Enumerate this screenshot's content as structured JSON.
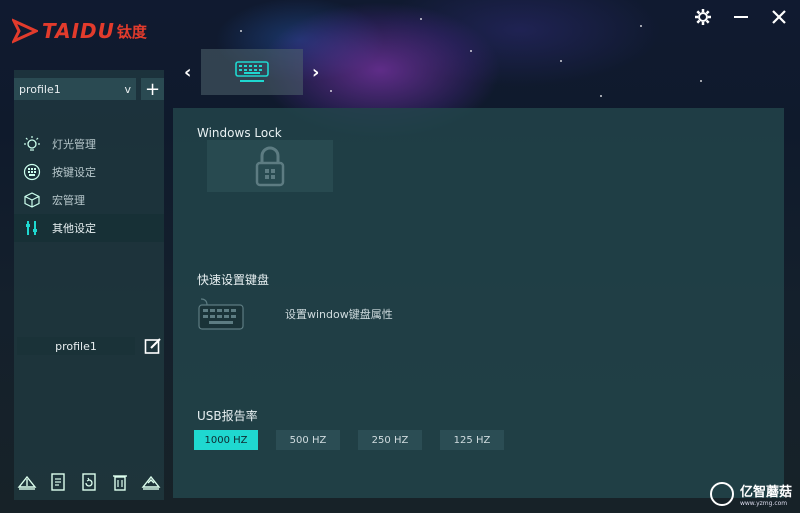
{
  "app": {
    "logo_text": "TAIDU",
    "logo_cn": "钛度"
  },
  "window_controls": {
    "settings_icon": "gear-icon",
    "minimize_icon": "minimize-icon",
    "close_icon": "close-icon"
  },
  "sidebar": {
    "profile_select": {
      "value": "profile1",
      "arrow": "v"
    },
    "add_label": "+",
    "menu": [
      {
        "label": "灯光管理",
        "icon": "light-bulb-icon",
        "active": false
      },
      {
        "label": "按键设定",
        "icon": "key-grid-icon",
        "active": false
      },
      {
        "label": "宏管理",
        "icon": "cube-icon",
        "active": false
      },
      {
        "label": "其他设定",
        "icon": "sliders-icon",
        "active": true
      }
    ],
    "profile_name": "profile1",
    "bottom_icons": [
      "import-icon",
      "document-icon",
      "export-icon",
      "trash-icon",
      "upload-icon"
    ]
  },
  "device_nav": {
    "prev": "‹",
    "next": "›",
    "device_icon": "keyboard-icon"
  },
  "main": {
    "windows_lock": {
      "title": "Windows Lock",
      "icon": "padlock-windows-icon"
    },
    "quick_keyboard": {
      "title": "快速设置键盘",
      "label": "设置window键盘属性",
      "icon": "keyboard-icon"
    },
    "usb_rate": {
      "title": "USB报告率",
      "options": [
        "1000 HZ",
        "500 HZ",
        "250 HZ",
        "125 HZ"
      ],
      "selected": "1000 HZ"
    }
  },
  "watermark": {
    "text": "亿智蘑菇",
    "sub": "www.yzmg.com"
  },
  "colors": {
    "accent": "#1fd8d0",
    "brand": "#e23b2c",
    "panel": "#22444a"
  }
}
